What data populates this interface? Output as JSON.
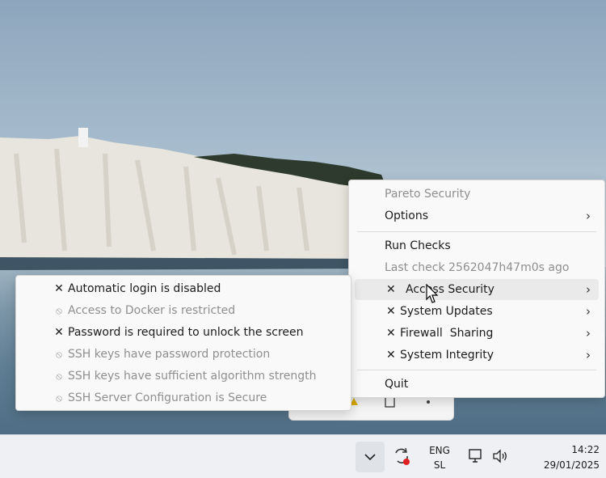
{
  "menu": {
    "title": "Pareto Security",
    "options_label": "Options",
    "run_checks_label": "Run Checks",
    "last_check": "Last check 2562047h47m0s ago",
    "categories": [
      {
        "label": "Access Security",
        "status_icon": "x-icon"
      },
      {
        "label": "System Updates",
        "status_icon": "x-icon"
      },
      {
        "label": "Firewall  Sharing",
        "status_icon": "x-icon"
      },
      {
        "label": "System Integrity",
        "status_icon": "x-icon"
      }
    ],
    "quit_label": "Quit"
  },
  "submenu": {
    "items": [
      {
        "label": "Automatic login is disabled",
        "state": "failed"
      },
      {
        "label": "Access to Docker is restricted",
        "state": "disabled"
      },
      {
        "label": "Password is required to unlock the screen",
        "state": "failed"
      },
      {
        "label": "SSH keys have password protection",
        "state": "disabled"
      },
      {
        "label": "SSH keys have sufficient algorithm strength",
        "state": "disabled"
      },
      {
        "label": "SSH Server Configuration is Secure",
        "state": "disabled"
      }
    ]
  },
  "taskbar": {
    "lang_line1": "ENG",
    "lang_line2": "SL",
    "time": "14:22",
    "date": "29/01/2025"
  },
  "icons": {
    "failed": "✕",
    "disabled": "⃠",
    "arrow": "›"
  },
  "colors": {
    "disabled_text": "#8f8f8f",
    "menu_bg": "#f9f9f9",
    "highlight_bg": "#eaeaea",
    "sync_badge": "#e02020"
  }
}
